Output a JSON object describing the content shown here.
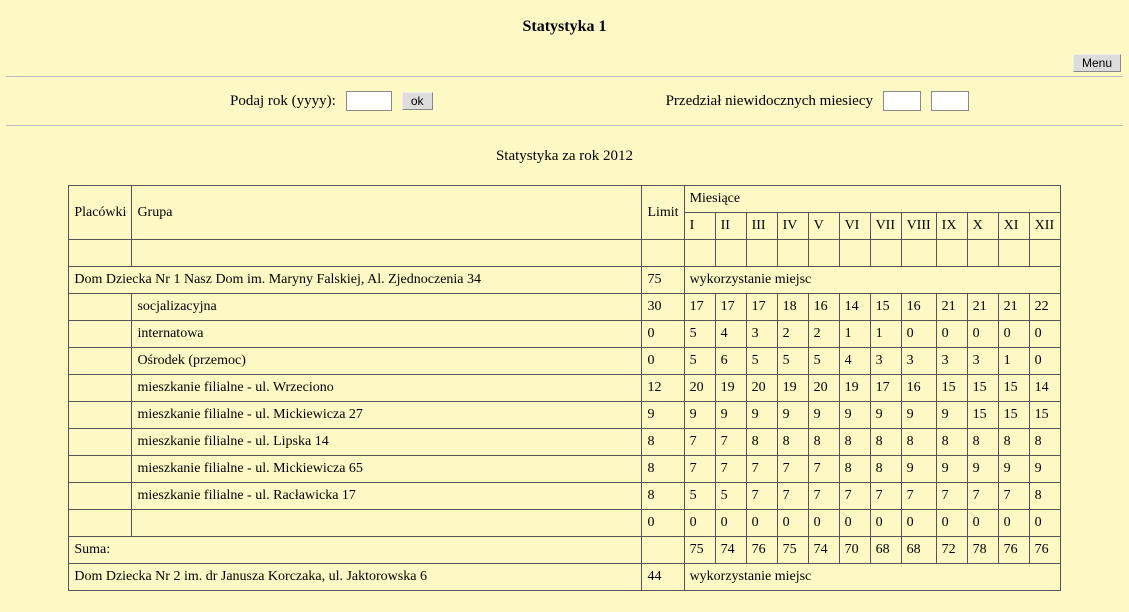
{
  "title": "Statystyka 1",
  "menu_button": "Menu",
  "form": {
    "year_label": "Podaj rok (yyyy):",
    "year_value": "",
    "ok_label": "ok",
    "range_label": "Przedział niewidocznych miesiecy",
    "range_from": "",
    "range_to": ""
  },
  "subtitle": "Statystyka za rok 2012",
  "columns": {
    "placowki": "Placówki",
    "grupa": "Grupa",
    "limit": "Limit",
    "miesiace": "Miesiące",
    "months": [
      "I",
      "II",
      "III",
      "IV",
      "V",
      "VI",
      "VII",
      "VIII",
      "IX",
      "X",
      "XI",
      "XII"
    ]
  },
  "section1": {
    "name": "Dom Dziecka Nr 1 Nasz Dom im. Maryny Falskiej, Al. Zjednoczenia 34",
    "limit": "75",
    "usage_label": "wykorzystanie miejsc",
    "rows": [
      {
        "grupa": "socjalizacyjna",
        "limit": "30",
        "m": [
          "17",
          "17",
          "17",
          "18",
          "16",
          "14",
          "15",
          "16",
          "21",
          "21",
          "21",
          "22"
        ]
      },
      {
        "grupa": "internatowa",
        "limit": "0",
        "m": [
          "5",
          "4",
          "3",
          "2",
          "2",
          "1",
          "1",
          "0",
          "0",
          "0",
          "0",
          "0"
        ]
      },
      {
        "grupa": "Ośrodek (przemoc)",
        "limit": "0",
        "m": [
          "5",
          "6",
          "5",
          "5",
          "5",
          "4",
          "3",
          "3",
          "3",
          "3",
          "1",
          "0"
        ]
      },
      {
        "grupa": "mieszkanie filialne - ul. Wrzeciono",
        "limit": "12",
        "m": [
          "20",
          "19",
          "20",
          "19",
          "20",
          "19",
          "17",
          "16",
          "15",
          "15",
          "15",
          "14"
        ]
      },
      {
        "grupa": "mieszkanie filialne - ul. Mickiewicza 27",
        "limit": "9",
        "m": [
          "9",
          "9",
          "9",
          "9",
          "9",
          "9",
          "9",
          "9",
          "9",
          "15",
          "15",
          "15"
        ]
      },
      {
        "grupa": "mieszkanie filialne - ul. Lipska 14",
        "limit": "8",
        "m": [
          "7",
          "7",
          "8",
          "8",
          "8",
          "8",
          "8",
          "8",
          "8",
          "8",
          "8",
          "8"
        ]
      },
      {
        "grupa": "mieszkanie filialne - ul. Mickiewicza 65",
        "limit": "8",
        "m": [
          "7",
          "7",
          "7",
          "7",
          "7",
          "8",
          "8",
          "9",
          "9",
          "9",
          "9",
          "9"
        ]
      },
      {
        "grupa": "mieszkanie filialne - ul. Racławicka 17",
        "limit": "8",
        "m": [
          "5",
          "5",
          "7",
          "7",
          "7",
          "7",
          "7",
          "7",
          "7",
          "7",
          "7",
          "8"
        ]
      }
    ],
    "zero_row": {
      "limit": "0",
      "m": [
        "0",
        "0",
        "0",
        "0",
        "0",
        "0",
        "0",
        "0",
        "0",
        "0",
        "0",
        "0"
      ]
    },
    "suma_label": "Suma:",
    "suma": [
      "75",
      "74",
      "76",
      "75",
      "74",
      "70",
      "68",
      "68",
      "72",
      "78",
      "76",
      "76"
    ]
  },
  "section2": {
    "name": "Dom Dziecka Nr 2 im. dr Janusza Korczaka, ul. Jaktorowska 6",
    "limit": "44",
    "usage_label": "wykorzystanie miejsc"
  }
}
